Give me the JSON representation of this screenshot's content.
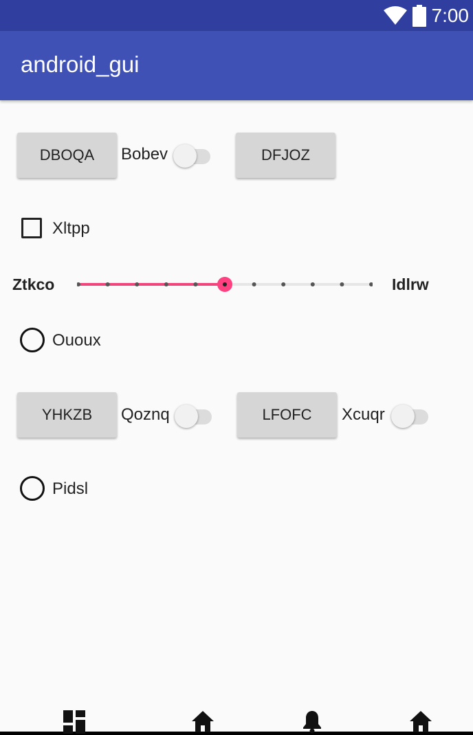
{
  "status_bar": {
    "time": "7:00"
  },
  "app_bar": {
    "title": "android_gui"
  },
  "row1": {
    "button1": "DBOQA",
    "switch_label": "Bobev",
    "button2": "DFJOZ"
  },
  "checkbox": {
    "label": "Xltpp",
    "checked": false
  },
  "seekbar": {
    "left_label": "Ztkco",
    "right_label": "Idlrw",
    "value": 5,
    "max": 10
  },
  "radio1": {
    "label": "Ououx",
    "checked": false
  },
  "row2": {
    "button1": "YHKZB",
    "switch1_label": "Qoznq",
    "button2": "LFOFC",
    "switch2_label": "Xcuqr"
  },
  "radio2": {
    "label": "Pidsl",
    "checked": false
  },
  "colors": {
    "primary": "#3f51b5",
    "primary_dark": "#303f9f",
    "accent": "#ff4081"
  },
  "bottom_nav": [
    "dashboard-icon",
    "home-icon",
    "notifications-icon",
    "home-icon"
  ]
}
